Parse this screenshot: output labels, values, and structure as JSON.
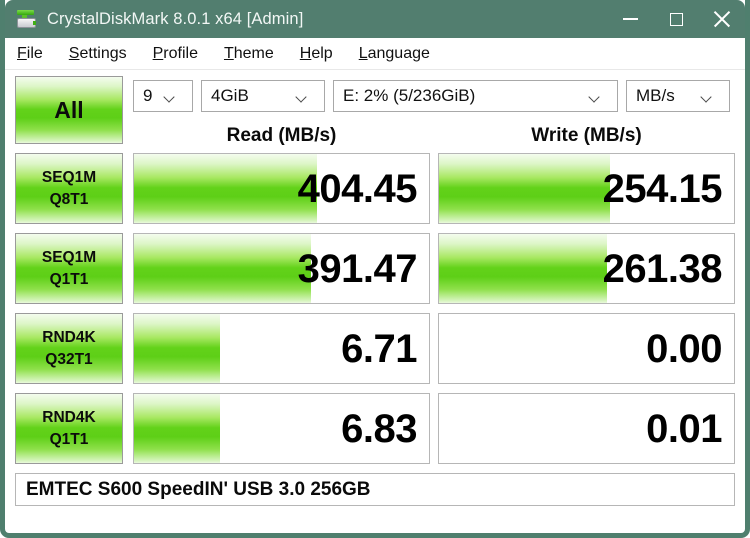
{
  "window": {
    "title": "CrystalDiskMark 8.0.1 x64 [Admin]",
    "titlebar_color": "#527e6f",
    "accent_green": "#5ecf17",
    "controls": {
      "minimize": "minimize",
      "maximize": "maximize",
      "close": "close"
    }
  },
  "menu": [
    {
      "accel": "F",
      "rest": "ile"
    },
    {
      "accel": "S",
      "rest": "ettings"
    },
    {
      "accel": "P",
      "rest": "rofile"
    },
    {
      "accel": "T",
      "rest": "heme"
    },
    {
      "accel": "H",
      "rest": "elp"
    },
    {
      "accel": "L",
      "rest": "anguage"
    }
  ],
  "toolbar": {
    "all_button": "All",
    "test_count": "9",
    "test_size": "4GiB",
    "drive": "E: 2% (5/236GiB)",
    "unit": "MB/s"
  },
  "headers": {
    "read": "Read (MB/s)",
    "write": "Write (MB/s)"
  },
  "rows": [
    {
      "label_top": "SEQ1M",
      "label_bottom": "Q8T1",
      "read": "404.45",
      "write": "254.15",
      "read_fill_pct": 62,
      "write_fill_pct": 58
    },
    {
      "label_top": "SEQ1M",
      "label_bottom": "Q1T1",
      "read": "391.47",
      "write": "261.38",
      "read_fill_pct": 60,
      "write_fill_pct": 57
    },
    {
      "label_top": "RND4K",
      "label_bottom": "Q32T1",
      "read": "6.71",
      "write": "0.00",
      "read_fill_pct": 29,
      "write_fill_pct": 0
    },
    {
      "label_top": "RND4K",
      "label_bottom": "Q1T1",
      "read": "6.83",
      "write": "0.01",
      "read_fill_pct": 29,
      "write_fill_pct": 0
    }
  ],
  "status": {
    "device": "EMTEC S600 SpeedIN' USB 3.0 256GB"
  }
}
